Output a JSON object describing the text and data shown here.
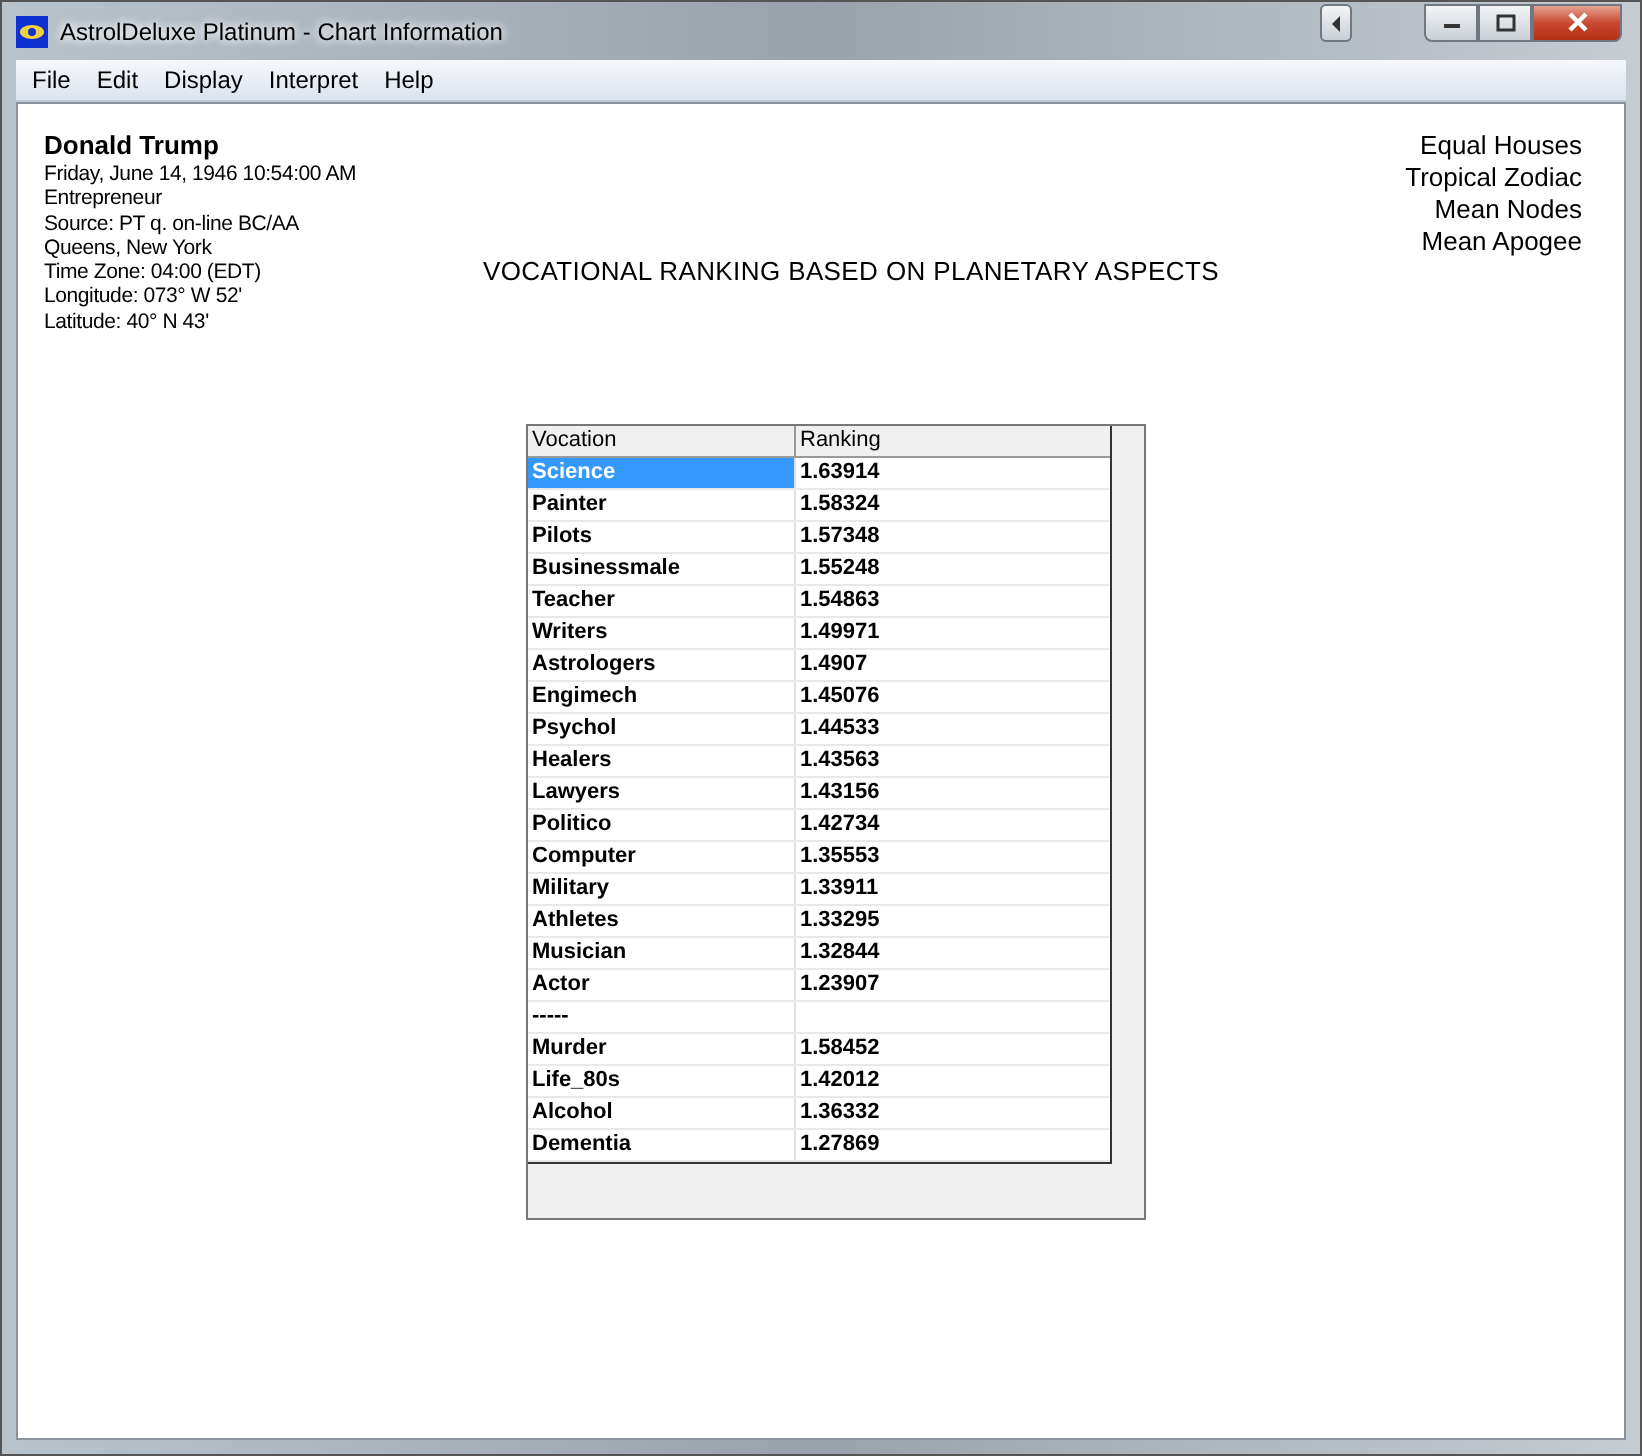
{
  "window": {
    "title": "AstrolDeluxe Platinum - Chart Information"
  },
  "menu": [
    "File",
    "Edit",
    "Display",
    "Interpret",
    "Help"
  ],
  "chart_info": {
    "name": "Donald Trump",
    "lines": [
      "Friday, June 14, 1946  10:54:00 AM",
      "Entrepreneur",
      "Source: PT q. on-line BC/AA",
      "Queens, New York",
      "Time Zone: 04:00 (EDT)",
      "Longitude: 073° W 52'",
      "Latitude: 40° N 43'"
    ]
  },
  "settings": [
    "Equal Houses",
    "Tropical Zodiac",
    "Mean Nodes",
    "Mean Apogee"
  ],
  "heading": "VOCATIONAL RANKING BASED ON PLANETARY ASPECTS",
  "table": {
    "columns": [
      "Vocation",
      "Ranking"
    ],
    "rows": [
      {
        "vocation": "Science",
        "ranking": "1.63914",
        "selected": true
      },
      {
        "vocation": "Painter",
        "ranking": "1.58324",
        "selected": false
      },
      {
        "vocation": "Pilots",
        "ranking": "1.57348",
        "selected": false
      },
      {
        "vocation": "Businessmale",
        "ranking": "1.55248",
        "selected": false
      },
      {
        "vocation": "Teacher",
        "ranking": "1.54863",
        "selected": false
      },
      {
        "vocation": "Writers",
        "ranking": "1.49971",
        "selected": false
      },
      {
        "vocation": "Astrologers",
        "ranking": "1.4907",
        "selected": false
      },
      {
        "vocation": "Engimech",
        "ranking": "1.45076",
        "selected": false
      },
      {
        "vocation": "Psychol",
        "ranking": "1.44533",
        "selected": false
      },
      {
        "vocation": "Healers",
        "ranking": "1.43563",
        "selected": false
      },
      {
        "vocation": "Lawyers",
        "ranking": "1.43156",
        "selected": false
      },
      {
        "vocation": "Politico",
        "ranking": "1.42734",
        "selected": false
      },
      {
        "vocation": "Computer",
        "ranking": "1.35553",
        "selected": false
      },
      {
        "vocation": "Military",
        "ranking": "1.33911",
        "selected": false
      },
      {
        "vocation": "Athletes",
        "ranking": "1.33295",
        "selected": false
      },
      {
        "vocation": "Musician",
        "ranking": "1.32844",
        "selected": false
      },
      {
        "vocation": "Actor",
        "ranking": "1.23907",
        "selected": false
      },
      {
        "vocation": "-----",
        "selected": false
      },
      {
        "vocation": "Murder",
        "ranking": "1.58452",
        "selected": false
      },
      {
        "vocation": "Life_80s",
        "ranking": "1.42012",
        "selected": false
      },
      {
        "vocation": "Alcohol",
        "ranking": "1.36332",
        "selected": false
      },
      {
        "vocation": "Dementia",
        "ranking": "1.27869",
        "selected": false
      }
    ]
  }
}
